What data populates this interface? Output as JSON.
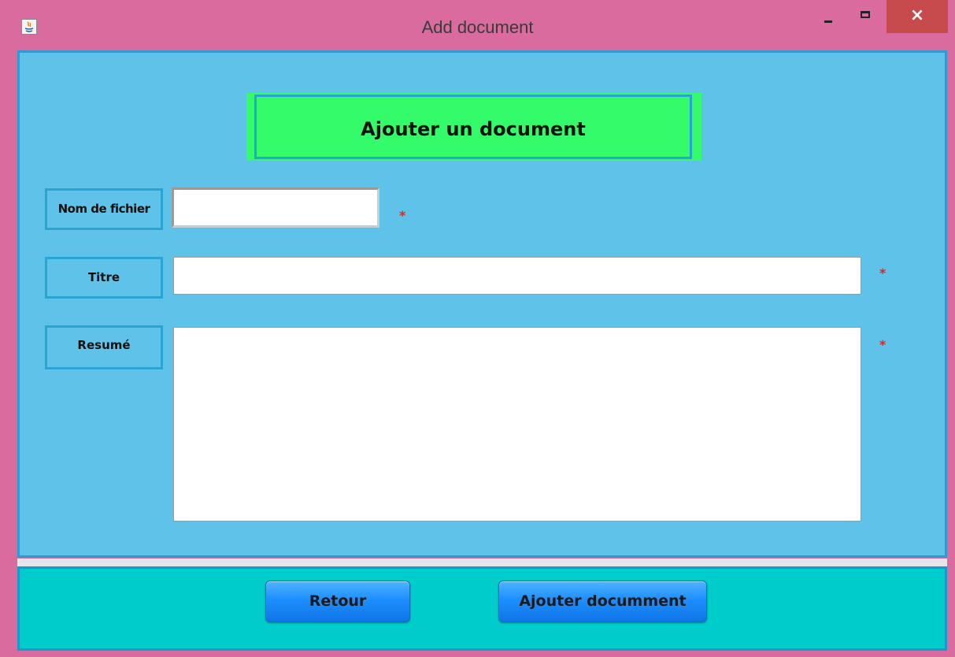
{
  "window": {
    "title": "Add document",
    "controls": {
      "minimize": "minimize",
      "maximize": "maximize",
      "close": "×"
    }
  },
  "header": {
    "title": "Ajouter un document"
  },
  "form": {
    "nom": {
      "label": "Nom de fichier",
      "value": "",
      "required_mark": "*"
    },
    "titre": {
      "label": "Titre",
      "value": "",
      "required_mark": "*"
    },
    "resume": {
      "label": "Resumé",
      "value": "",
      "required_mark": "*"
    }
  },
  "buttons": {
    "retour": "Retour",
    "ajouter": "Ajouter documment"
  },
  "colors": {
    "title_bar": "#d96b9f",
    "main_panel": "#5fc2e9",
    "header_banner": "#34fb6a",
    "button_panel": "#00cccc",
    "button": "#1e8fff",
    "required": "#e52222",
    "close_button": "#c74a4d"
  }
}
